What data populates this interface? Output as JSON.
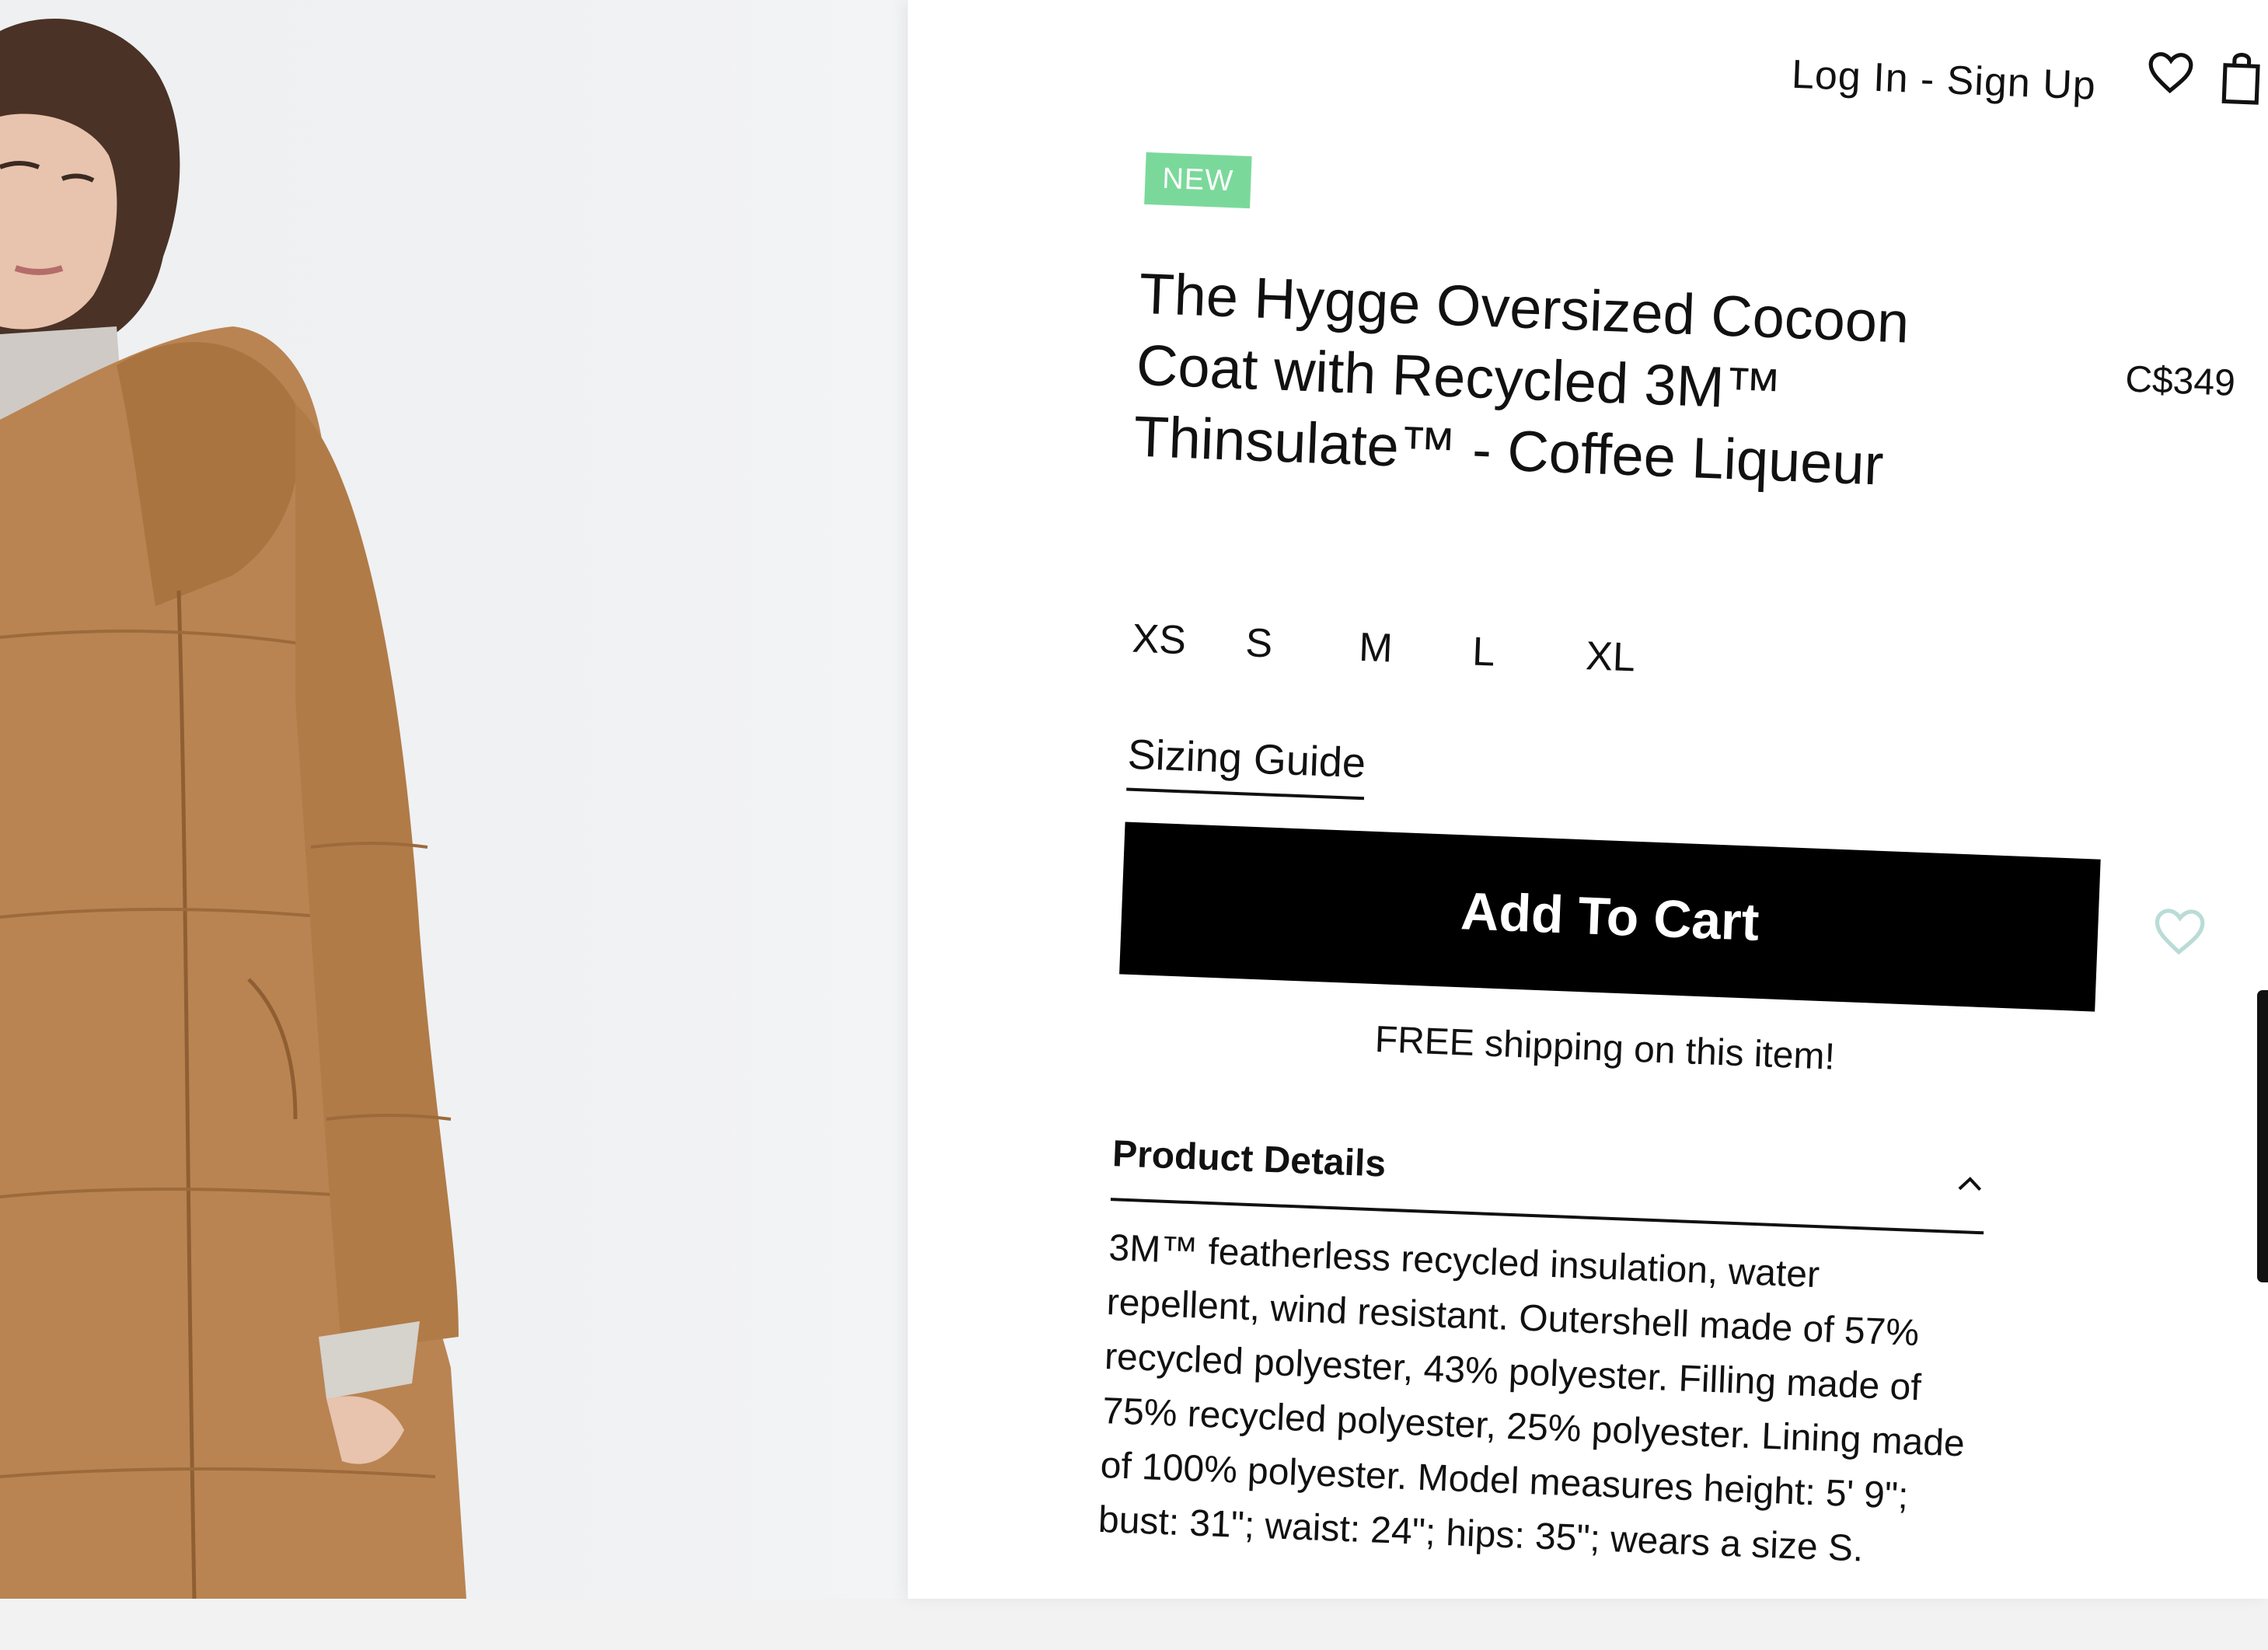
{
  "header": {
    "auth_link": "Log In - Sign Up",
    "wishlist_icon": "heart-icon",
    "bag_icon": "shopping-bag-icon"
  },
  "product": {
    "badge": "NEW",
    "title": "The Hygge Oversized Cocoon Coat with Recycled 3M™ Thinsulate™ - Coffee Liqueur",
    "price": "C$349",
    "sizes": [
      "XS",
      "S",
      "M",
      "L",
      "XL"
    ],
    "sizing_guide_label": "Sizing Guide",
    "add_to_cart_label": "Add To Cart",
    "shipping_note": "FREE shipping on this item!",
    "details_title": "Product Details",
    "details_text": "3M™ featherless recycled insulation, water repellent, wind resistant. Outershell made of 57% recycled polyester, 43% polyester. Filling made of 75% recycled polyester, 25% polyester. Lining made of 100% polyester. Model measures height: 5' 9\"; bust: 31\"; waist: 24\"; hips: 35\"; wears a size S."
  },
  "colors": {
    "badge_green": "#7ad99a",
    "button_black": "#000000",
    "coat_tan": "#b98452",
    "wishlist_outline": "#b9dcd6"
  }
}
